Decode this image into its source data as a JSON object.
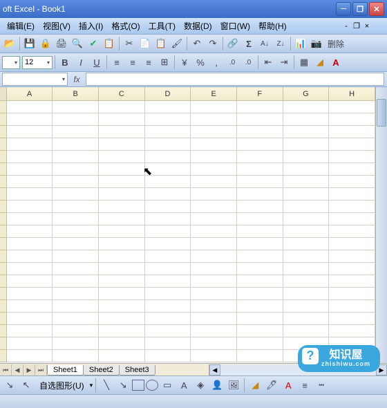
{
  "titlebar": {
    "title": "oft Excel - Book1"
  },
  "menu": {
    "edit": "编辑(E)",
    "view": "视图(V)",
    "insert": "插入(I)",
    "format": "格式(O)",
    "tools": "工具(T)",
    "data": "数据(D)",
    "window": "窗口(W)",
    "help": "帮助(H)"
  },
  "toolbar2": {
    "fontsize": "12",
    "delete_label": "删除"
  },
  "formula": {
    "namebox": "",
    "fx": "fx"
  },
  "columns": [
    "A",
    "B",
    "C",
    "D",
    "E",
    "F",
    "G",
    "H"
  ],
  "sheets": {
    "s1": "Sheet1",
    "s2": "Sheet2",
    "s3": "Sheet3"
  },
  "drawbar": {
    "autoshape": "自选图形(U)"
  },
  "watermark": {
    "text": "知识屋",
    "sub": "zhishiwu.com",
    "q": "?"
  }
}
